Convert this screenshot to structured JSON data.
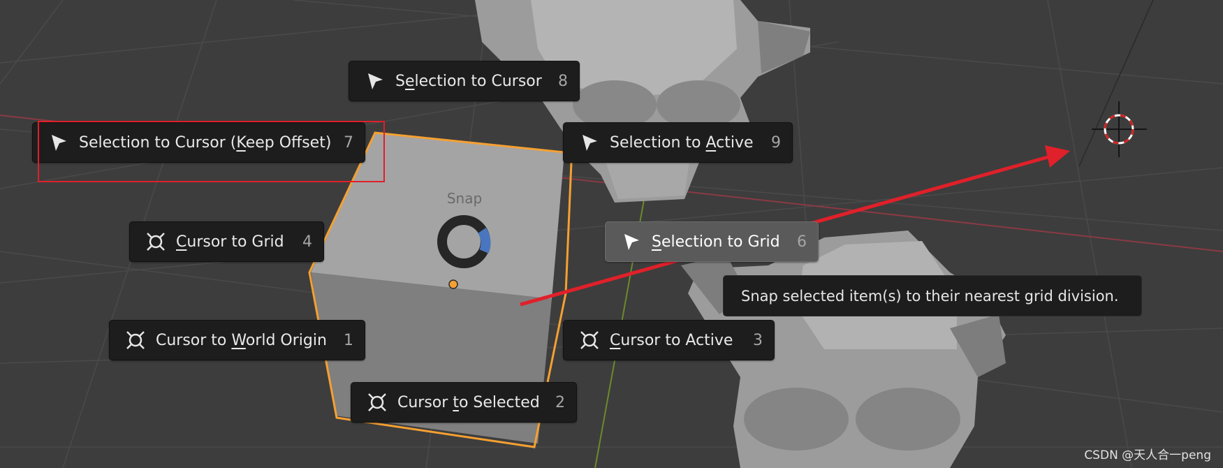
{
  "pie_menu": {
    "title": "Snap",
    "items": [
      {
        "pre": "S",
        "ul": "e",
        "post": "lection to Cursor",
        "key": "8",
        "icon": "cursor-arrow-icon"
      },
      {
        "pre": "Selection to Cursor (",
        "ul": "K",
        "post": "eep Offset)",
        "key": "7",
        "icon": "cursor-arrow-icon"
      },
      {
        "pre": "Selection to ",
        "ul": "A",
        "post": "ctive",
        "key": "9",
        "icon": "cursor-arrow-icon"
      },
      {
        "pre": "",
        "ul": "C",
        "post": "ursor to Grid",
        "key": "4",
        "icon": "3d-cursor-icon"
      },
      {
        "pre": "",
        "ul": "S",
        "post": "election to Grid",
        "key": "6",
        "icon": "cursor-arrow-icon"
      },
      {
        "pre": "Cursor to ",
        "ul": "W",
        "post": "orld Origin",
        "key": "1",
        "icon": "3d-cursor-icon"
      },
      {
        "pre": "",
        "ul": "C",
        "post": "ursor to Active",
        "key": "3",
        "icon": "3d-cursor-icon"
      },
      {
        "pre": "Cursor ",
        "ul": "t",
        "post": "o Selected",
        "key": "2",
        "icon": "3d-cursor-icon"
      }
    ]
  },
  "tooltip": {
    "text": "Snap selected item(s) to their nearest grid division."
  },
  "watermark": {
    "text": "CSDN @天人合一peng"
  },
  "colors": {
    "annotation": "#e0202a",
    "selection_outline": "#f5a032",
    "pie_direction": "#4a76c0"
  }
}
